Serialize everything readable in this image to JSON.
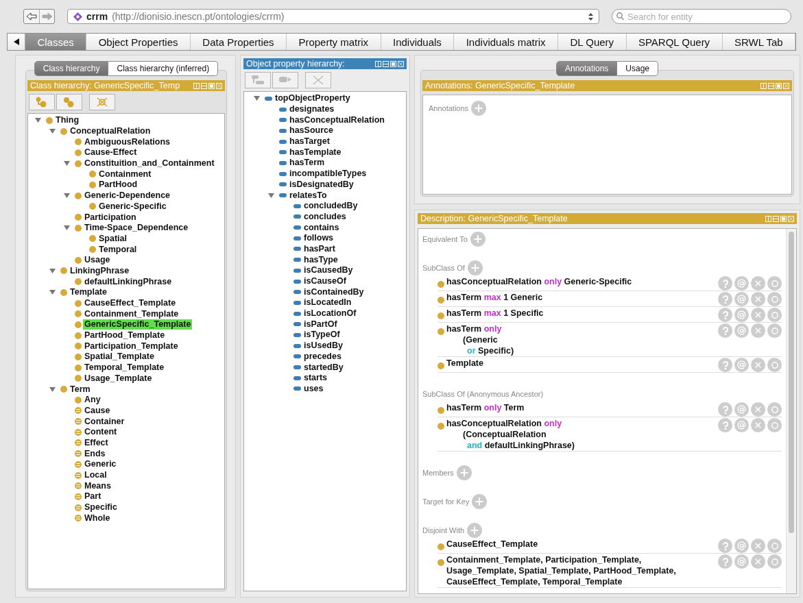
{
  "toolbar": {
    "back_disabled": false,
    "forward_disabled": true,
    "address": {
      "name": "crrm",
      "url": "(http://dionisio.inescn.pt/ontologies/crrm)"
    },
    "search": {
      "placeholder": "Search for entity"
    }
  },
  "tabs": [
    {
      "label": "Classes",
      "selected": true
    },
    {
      "label": "Object Properties",
      "selected": false
    },
    {
      "label": "Data Properties",
      "selected": false
    },
    {
      "label": "Property matrix",
      "selected": false
    },
    {
      "label": "Individuals",
      "selected": false
    },
    {
      "label": "Individuals matrix",
      "selected": false
    },
    {
      "label": "DL Query",
      "selected": false
    },
    {
      "label": "SPARQL Query",
      "selected": false
    },
    {
      "label": "SRWL Tab",
      "selected": false
    }
  ],
  "class_panel": {
    "view_tabs": [
      {
        "label": "Class hierarchy",
        "selected": true
      },
      {
        "label": "Class hierarchy (inferred)",
        "selected": false
      }
    ],
    "title": "Class hierarchy: GenericSpecific_Temp",
    "toolbar_disabled": false,
    "tree": [
      {
        "label": "Thing",
        "kind": "class",
        "expanded": true,
        "selected": false,
        "children": [
          {
            "label": "ConceptualRelation",
            "kind": "class",
            "expanded": true,
            "selected": false,
            "children": [
              {
                "label": "AmbiguousRelations",
                "kind": "class",
                "selected": false
              },
              {
                "label": "Cause-Effect",
                "kind": "class",
                "selected": false
              },
              {
                "label": "Constituition_and_Containment",
                "kind": "class",
                "expanded": true,
                "selected": false,
                "children": [
                  {
                    "label": "Containment",
                    "kind": "class",
                    "selected": false
                  },
                  {
                    "label": "PartHood",
                    "kind": "class",
                    "selected": false
                  }
                ]
              },
              {
                "label": "Generic-Dependence",
                "kind": "class",
                "expanded": true,
                "selected": false,
                "children": [
                  {
                    "label": "Generic-Specific",
                    "kind": "class",
                    "selected": false
                  }
                ]
              },
              {
                "label": "Participation",
                "kind": "class",
                "selected": false
              },
              {
                "label": "Time-Space_Dependence",
                "kind": "class",
                "expanded": true,
                "selected": false,
                "children": [
                  {
                    "label": "Spatial",
                    "kind": "class",
                    "selected": false
                  },
                  {
                    "label": "Temporal",
                    "kind": "class",
                    "selected": false
                  }
                ]
              },
              {
                "label": "Usage",
                "kind": "class",
                "selected": false
              }
            ]
          },
          {
            "label": "LinkingPhrase",
            "kind": "class",
            "expanded": true,
            "selected": false,
            "children": [
              {
                "label": "defaultLinkingPhrase",
                "kind": "class",
                "selected": false
              }
            ]
          },
          {
            "label": "Template",
            "kind": "class",
            "expanded": true,
            "selected": false,
            "children": [
              {
                "label": "CauseEffect_Template",
                "kind": "class",
                "selected": false
              },
              {
                "label": "Containment_Template",
                "kind": "class",
                "selected": false
              },
              {
                "label": "GenericSpecific_Template",
                "kind": "class",
                "selected": true
              },
              {
                "label": "PartHood_Template",
                "kind": "class",
                "selected": false
              },
              {
                "label": "Participation_Template",
                "kind": "class",
                "selected": false
              },
              {
                "label": "Spatial_Template",
                "kind": "class",
                "selected": false
              },
              {
                "label": "Temporal_Template",
                "kind": "class",
                "selected": false
              },
              {
                "label": "Usage_Template",
                "kind": "class",
                "selected": false
              }
            ]
          },
          {
            "label": "Term",
            "kind": "class",
            "expanded": true,
            "selected": false,
            "children": [
              {
                "label": "Any",
                "kind": "class",
                "selected": false
              },
              {
                "label": "Cause",
                "kind": "defined",
                "selected": false
              },
              {
                "label": "Container",
                "kind": "defined",
                "selected": false
              },
              {
                "label": "Content",
                "kind": "defined",
                "selected": false
              },
              {
                "label": "Effect",
                "kind": "defined",
                "selected": false
              },
              {
                "label": "Ends",
                "kind": "defined",
                "selected": false
              },
              {
                "label": "Generic",
                "kind": "defined",
                "selected": false
              },
              {
                "label": "Local",
                "kind": "defined",
                "selected": false
              },
              {
                "label": "Means",
                "kind": "defined",
                "selected": false
              },
              {
                "label": "Part",
                "kind": "defined",
                "selected": false
              },
              {
                "label": "Specific",
                "kind": "defined",
                "selected": false
              },
              {
                "label": "Whole",
                "kind": "defined",
                "selected": false
              }
            ]
          }
        ]
      }
    ]
  },
  "property_panel": {
    "title": "Object property hierarchy:",
    "toolbar_disabled": true,
    "tree": [
      {
        "label": "topObjectProperty",
        "kind": "property",
        "expanded": true,
        "children": [
          {
            "label": "designates",
            "kind": "property"
          },
          {
            "label": "hasConceptualRelation",
            "kind": "property"
          },
          {
            "label": "hasSource",
            "kind": "property"
          },
          {
            "label": "hasTarget",
            "kind": "property"
          },
          {
            "label": "hasTemplate",
            "kind": "property"
          },
          {
            "label": "hasTerm",
            "kind": "property"
          },
          {
            "label": "incompatibleTypes",
            "kind": "property"
          },
          {
            "label": "isDesignatedBy",
            "kind": "property"
          },
          {
            "label": "relatesTo",
            "kind": "property",
            "expanded": true,
            "children": [
              {
                "label": "concludedBy",
                "kind": "property"
              },
              {
                "label": "concludes",
                "kind": "property"
              },
              {
                "label": "contains",
                "kind": "property"
              },
              {
                "label": "follows",
                "kind": "property"
              },
              {
                "label": "hasPart",
                "kind": "property"
              },
              {
                "label": "hasType",
                "kind": "property"
              },
              {
                "label": "isCausedBy",
                "kind": "property"
              },
              {
                "label": "isCauseOf",
                "kind": "property"
              },
              {
                "label": "isContainedBy",
                "kind": "property"
              },
              {
                "label": "isLocatedIn",
                "kind": "property"
              },
              {
                "label": "isLocationOf",
                "kind": "property"
              },
              {
                "label": "isPartOf",
                "kind": "property"
              },
              {
                "label": "isTypeOf",
                "kind": "property"
              },
              {
                "label": "isUsedBy",
                "kind": "property"
              },
              {
                "label": "precedes",
                "kind": "property"
              },
              {
                "label": "startedBy",
                "kind": "property"
              },
              {
                "label": "starts",
                "kind": "property"
              },
              {
                "label": "uses",
                "kind": "property"
              }
            ]
          }
        ]
      }
    ]
  },
  "annotations_panel": {
    "view_tabs": [
      {
        "label": "Annotations",
        "selected": true
      },
      {
        "label": "Usage",
        "selected": false
      }
    ],
    "title": "Annotations: GenericSpecific_Template",
    "section": "Annotations"
  },
  "description_panel": {
    "title": "Description: GenericSpecific_Template",
    "sections": [
      {
        "label": "Equivalent To"
      },
      {
        "label": "SubClass Of",
        "items": [
          {
            "kind": "expression",
            "lines": [
              [
                {
                  "text": "hasConceptualRelation ",
                  "kind": "name"
                },
                {
                  "text": "only",
                  "kind": "keyword"
                },
                {
                  "text": " Generic-Specific",
                  "kind": "name"
                }
              ]
            ]
          },
          {
            "kind": "expression",
            "lines": [
              [
                {
                  "text": "hasTerm ",
                  "kind": "name"
                },
                {
                  "text": "max",
                  "kind": "keyword"
                },
                {
                  "text": " 1 Generic",
                  "kind": "name"
                }
              ]
            ]
          },
          {
            "kind": "expression",
            "lines": [
              [
                {
                  "text": "hasTerm ",
                  "kind": "name"
                },
                {
                  "text": "max",
                  "kind": "keyword"
                },
                {
                  "text": " 1 Specific",
                  "kind": "name"
                }
              ]
            ]
          },
          {
            "kind": "expression",
            "lines": [
              [
                {
                  "text": "hasTerm ",
                  "kind": "name"
                },
                {
                  "text": "only",
                  "kind": "keyword"
                }
              ],
              [
                {
                  "text": "(Generic",
                  "kind": "name"
                }
              ],
              [
                {
                  "text": "or",
                  "kind": "connective"
                },
                {
                  "text": " Specific)",
                  "kind": "name"
                }
              ]
            ]
          },
          {
            "kind": "expression",
            "lines": [
              [
                {
                  "text": "Template",
                  "kind": "name"
                }
              ]
            ]
          }
        ]
      },
      {
        "label": "SubClass Of (Anonymous Ancestor)",
        "add_button": false,
        "items": [
          {
            "kind": "expression",
            "lines": [
              [
                {
                  "text": "hasTerm ",
                  "kind": "name"
                },
                {
                  "text": "only",
                  "kind": "keyword"
                },
                {
                  "text": " Term",
                  "kind": "name"
                }
              ]
            ]
          },
          {
            "kind": "expression",
            "lines": [
              [
                {
                  "text": "hasConceptualRelation ",
                  "kind": "name"
                },
                {
                  "text": "only",
                  "kind": "keyword"
                }
              ],
              [
                {
                  "text": "(ConceptualRelation",
                  "kind": "name"
                }
              ],
              [
                {
                  "text": "and",
                  "kind": "connective"
                },
                {
                  "text": " defaultLinkingPhrase)",
                  "kind": "name"
                }
              ]
            ]
          }
        ]
      },
      {
        "label": "Members"
      },
      {
        "label": "Target for Key"
      },
      {
        "label": "Disjoint With",
        "items": [
          {
            "kind": "list",
            "lines": [
              [
                {
                  "text": "CauseEffect_Template",
                  "kind": "name"
                }
              ]
            ]
          },
          {
            "kind": "list",
            "lines": [
              [
                {
                  "text": "Containment_Template, Participation_Template,",
                  "kind": "name"
                }
              ],
              [
                {
                  "text": "Usage_Template, Spatial_Template, PartHood_Template,",
                  "kind": "name"
                }
              ],
              [
                {
                  "text": "CauseEffect_Template, Temporal_Template",
                  "kind": "name"
                }
              ]
            ]
          }
        ]
      }
    ]
  }
}
